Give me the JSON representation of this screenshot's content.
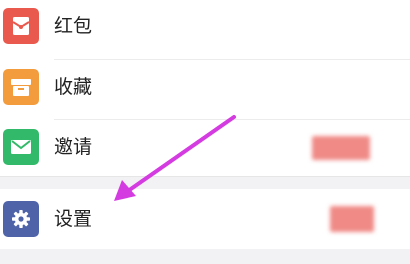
{
  "menu": {
    "items": [
      {
        "label": "红包",
        "icon": "red-packet-icon",
        "color": "#e9594d"
      },
      {
        "label": "收藏",
        "icon": "favorites-box-icon",
        "color": "#f39c3d"
      },
      {
        "label": "邀请",
        "icon": "mail-icon",
        "color": "#33b96a"
      }
    ],
    "settings": {
      "label": "设置",
      "icon": "gear-icon",
      "color": "#4f64a8"
    }
  },
  "annotation": {
    "arrow_color": "#d43be0"
  }
}
